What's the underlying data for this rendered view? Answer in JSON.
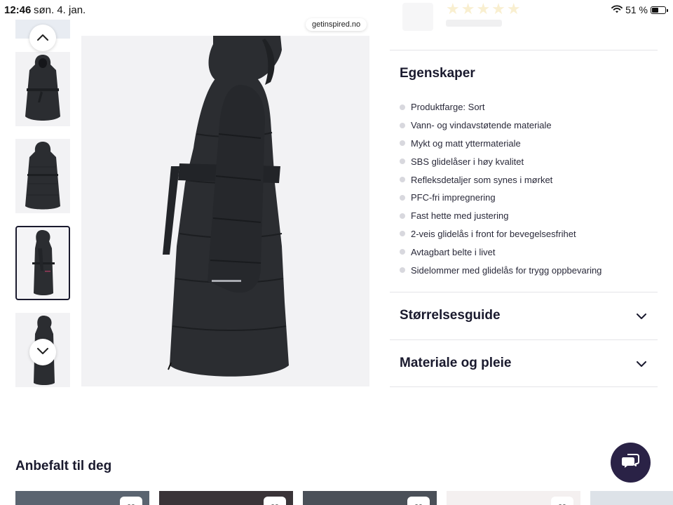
{
  "status_bar": {
    "time": "12:46",
    "date": "søn. 4. jan.",
    "battery_percent": "51 %",
    "battery_level": 0.51
  },
  "browser": {
    "url": "getinspired.no"
  },
  "gallery": {
    "thumbnails": [
      {
        "name": "thumb-front-belted",
        "selected": false
      },
      {
        "name": "thumb-back",
        "selected": false
      },
      {
        "name": "thumb-side",
        "selected": true
      },
      {
        "name": "thumb-side-back",
        "selected": false
      }
    ],
    "prev_icon": "chevron-up-icon",
    "next_icon": "chevron-down-icon"
  },
  "product": {
    "rating_stars": "★★★★★"
  },
  "features": {
    "title": "Egenskaper",
    "items": [
      "Produktfarge: Sort",
      "Vann- og vindavstøtende materiale",
      "Mykt og matt yttermateriale",
      "SBS glidelåser i høy kvalitet",
      "Refleksdetaljer som synes i mørket",
      "PFC-fri impregnering",
      "Fast hette med justering",
      "2-veis glidelås i front for bevegelsesfrihet",
      "Avtagbart belte i livet",
      "Sidelommer med glidelås for trygg oppbevaring"
    ]
  },
  "accordions": [
    {
      "label": "Størrelsesguide",
      "icon": "chevron-down-icon"
    },
    {
      "label": "Materiale og pleie",
      "icon": "chevron-down-icon"
    }
  ],
  "recommended": {
    "title": "Anbefalt til deg",
    "card_colors": [
      "#5a6470",
      "#3a3438",
      "#4a5058",
      "#f4f0f0",
      "#dde2e8"
    ]
  },
  "colors": {
    "brand_dark": "#2a2246",
    "text": "#1a1a2e",
    "coat": "#2b2d31"
  },
  "chat": {
    "icon": "chat-bubbles-icon"
  }
}
